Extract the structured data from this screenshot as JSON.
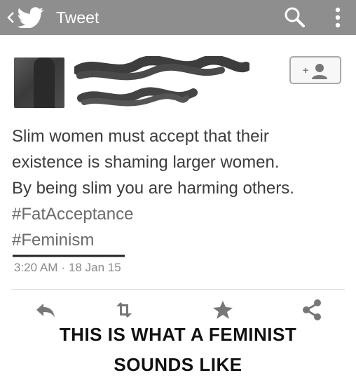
{
  "topbar": {
    "title": "Tweet",
    "icons": [
      "chevron-left-icon",
      "twitter-bird-icon",
      "search-icon",
      "more-vertical-icon"
    ]
  },
  "header": {
    "follow_icon": "add-user-icon"
  },
  "tweet": {
    "lines": [
      "Slim women must accept that their",
      "existence is shaming larger women.",
      "By being slim you are harming others."
    ],
    "hashtags": [
      "#FatAcceptance",
      "#Feminism"
    ],
    "time": "3:20 AM",
    "separator": "·",
    "date": "18 Jan 15"
  },
  "actions": [
    "reply-icon",
    "retweet-icon",
    "favorite-icon",
    "share-icon"
  ],
  "caption": {
    "line1": "THIS IS WHAT A FEMINIST",
    "line2": "SOUNDS LIKE"
  },
  "colors": {
    "topbar": "#8e8e8e",
    "text": "#3c3c3c",
    "hashtag": "#6a6a6a",
    "caption": "#111111"
  }
}
